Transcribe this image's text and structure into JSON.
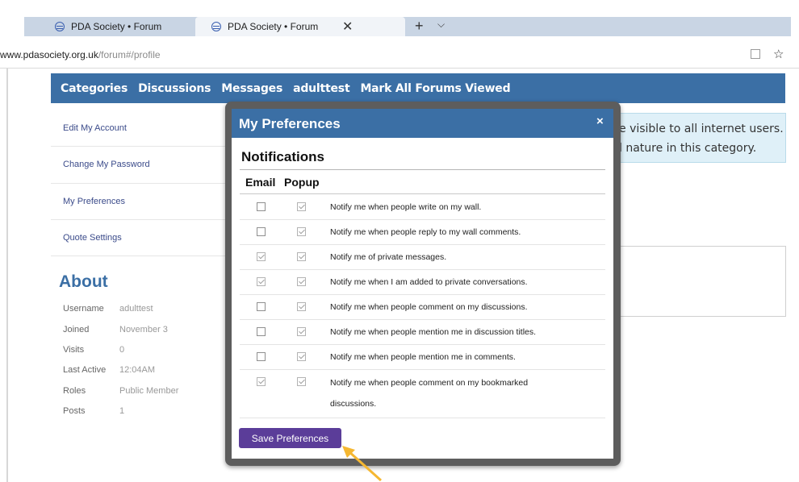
{
  "browser": {
    "tab_inactive": "PDA Society • Forum",
    "tab_active": "PDA Society • Forum",
    "tab_close": "✕",
    "new_tab": "+",
    "tab_list": "⌵",
    "url_domain": "www.pdasociety.org.uk",
    "url_path": "/forum#/profile"
  },
  "nav": {
    "items": [
      "Categories",
      "Discussions",
      "Messages",
      "adulttest",
      "Mark All Forums Viewed"
    ]
  },
  "sidebar": {
    "links": [
      "Edit My Account",
      "Change My Password",
      "My Preferences",
      "Quote Settings"
    ]
  },
  "about": {
    "title": "About",
    "rows": [
      {
        "key": "Username",
        "value": "adulttest"
      },
      {
        "key": "Joined",
        "value": "November 3"
      },
      {
        "key": "Visits",
        "value": "0"
      },
      {
        "key": "Last Active",
        "value": "12:04AM"
      },
      {
        "key": "Roles",
        "value": "Public Member"
      },
      {
        "key": "Posts",
        "value": "1"
      }
    ]
  },
  "notice": {
    "line1": "e visible to all internet users.",
    "line2": "l nature in this category."
  },
  "modal": {
    "title": "My Preferences",
    "close": "×",
    "section": "Notifications",
    "col_email": "Email",
    "col_popup": "Popup",
    "rows": [
      {
        "label": "Notify me when people write on my wall.",
        "email": false,
        "popup": true
      },
      {
        "label": "Notify me when people reply to my wall comments.",
        "email": false,
        "popup": true
      },
      {
        "label": "Notify me of private messages.",
        "email": true,
        "popup": true
      },
      {
        "label": "Notify me when I am added to private conversations.",
        "email": true,
        "popup": true
      },
      {
        "label": "Notify me when people comment on my discussions.",
        "email": false,
        "popup": true
      },
      {
        "label": "Notify me when people mention me in discussion titles.",
        "email": false,
        "popup": true
      },
      {
        "label": "Notify me when people mention me in comments.",
        "email": false,
        "popup": true
      },
      {
        "label": "Notify me when people comment on my bookmarked discussions.",
        "email": true,
        "popup": true
      }
    ],
    "save_label": "Save Preferences"
  },
  "colors": {
    "nav_blue": "#3b6fa5",
    "save_purple": "#5b3d99",
    "arrow_orange": "#f5b731"
  }
}
